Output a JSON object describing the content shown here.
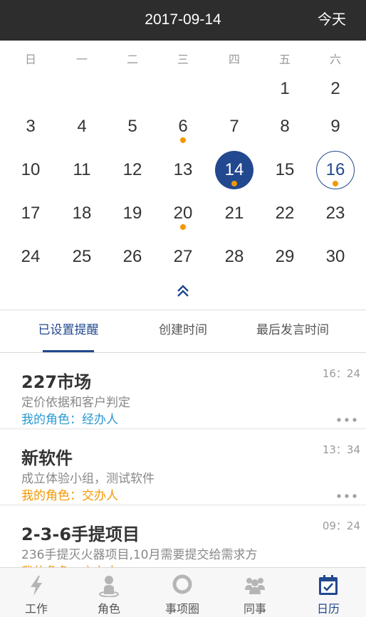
{
  "header": {
    "date": "2017-09-14",
    "today_button": "今天"
  },
  "calendar": {
    "weekdays": [
      "日",
      "一",
      "二",
      "三",
      "四",
      "五",
      "六"
    ],
    "days": [
      "1",
      "2",
      "3",
      "4",
      "5",
      "6",
      "7",
      "8",
      "9",
      "10",
      "11",
      "12",
      "13",
      "14",
      "15",
      "16",
      "17",
      "18",
      "19",
      "20",
      "21",
      "22",
      "23",
      "24",
      "25",
      "26",
      "27",
      "28",
      "29",
      "30"
    ],
    "first_weekday_index": 5,
    "selected_day": "14",
    "today_day": "16",
    "days_with_reminders": [
      "6",
      "14",
      "16",
      "20"
    ],
    "collapse_icon": "double-chevron-up-icon"
  },
  "tabs": [
    {
      "label": "已设置提醒",
      "active": true
    },
    {
      "label": "创建时间",
      "active": false
    },
    {
      "label": "最后发言时间",
      "active": false
    }
  ],
  "items": [
    {
      "title": "227市场",
      "desc": "定价依据和客户判定",
      "role": "我的角色：经办人",
      "time": "16：24",
      "role_color": "#2a98d2"
    },
    {
      "title": "新软件",
      "desc": "成立体验小组，测试软件",
      "role": "我的角色：交办人",
      "time": "13：34",
      "role_color": "#f39800"
    },
    {
      "title": "2-3-6手提项目",
      "desc": "236手提灭火器项目,10月需要提交给需求方",
      "role": "我的角色：交办人",
      "time": "09：24",
      "role_color": "#f39800"
    }
  ],
  "bottom_nav": [
    {
      "label": "工作",
      "icon": "lightning-icon",
      "active": false
    },
    {
      "label": "角色",
      "icon": "person-icon",
      "active": false
    },
    {
      "label": "事项圈",
      "icon": "circle-icon",
      "active": false
    },
    {
      "label": "同事",
      "icon": "group-icon",
      "active": false
    },
    {
      "label": "日历",
      "icon": "calendar-check-icon",
      "active": true
    }
  ],
  "colors": {
    "accent": "#22488f",
    "reminder_dot": "#f39800",
    "header_bg": "#2d2d2d"
  }
}
